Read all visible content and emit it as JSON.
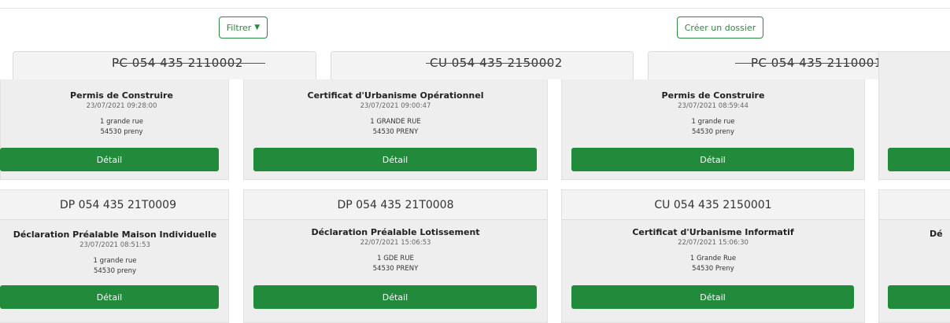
{
  "toolbar": {
    "filter_label": "Filtrer",
    "create_label": "Créer un dossier"
  },
  "row1": [
    {
      "code": "PC 054 435 2110002",
      "type": "Permis de Construire",
      "date": "23/07/2021 09:28:00",
      "street": "1 grande rue",
      "city": "54530 preny",
      "button": "Détail"
    },
    {
      "code": "CU 054 435 2150002",
      "type": "Certificat d'Urbanisme Opérationnel",
      "date": "23/07/2021 09:00:47",
      "street": "1 GRANDE RUE",
      "city": "54530 PRENY",
      "button": "Détail"
    },
    {
      "code": "PC 054 435 2110001",
      "type": "Permis de Construire",
      "date": "23/07/2021 08:59:44",
      "street": "1 grande rue",
      "city": "54530 preny",
      "button": "Détail"
    }
  ],
  "row2": [
    {
      "code": "DP 054 435 21T0009",
      "type": "Déclaration Préalable Maison Individuelle",
      "date": "23/07/2021 08:51:53",
      "street": "1 grande rue",
      "city": "54530 preny",
      "button": "Détail"
    },
    {
      "code": "DP 054 435 21T0008",
      "type": "Déclaration Préalable Lotissement",
      "date": "22/07/2021 15:06:53",
      "street": "1 GDE RUE",
      "city": "54530 PRENY",
      "button": "Détail"
    },
    {
      "code": "CU 054 435 2150001",
      "type": "Certificat d'Urbanisme Informatif",
      "date": "22/07/2021 15:06:30",
      "street": "1 Grande Rue",
      "city": "54530 Preny",
      "button": "Détail"
    }
  ],
  "row2_partial_type": "Dé"
}
